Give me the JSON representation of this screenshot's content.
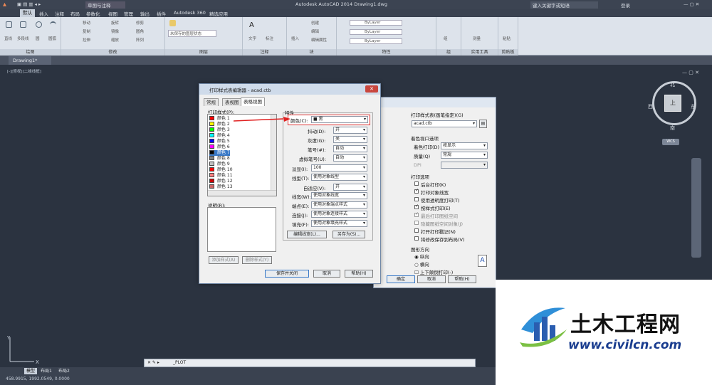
{
  "titlebar": {
    "workspace": "草图与注释",
    "app_title": "Autodesk AutoCAD 2014    Drawing1.dwg",
    "search_placeholder": "键入关键字或短语",
    "login": "登录"
  },
  "menu_tabs": [
    "默认",
    "插入",
    "注释",
    "布局",
    "参数化",
    "视图",
    "管理",
    "输出",
    "插件",
    "Autodesk 360",
    "精选应用"
  ],
  "ribbon": {
    "groups": [
      "绘图",
      "修改",
      "图层",
      "注释",
      "块",
      "特性",
      "组",
      "实用工具",
      "剪贴板"
    ],
    "draw_tools": [
      "直线",
      "多段线",
      "圆",
      "圆弧"
    ],
    "modify_tools": [
      "移动",
      "旋转",
      "修剪",
      "复制",
      "镜像",
      "圆角",
      "拉伸",
      "缩放",
      "阵列"
    ],
    "layer_state": "未保存的图层状态",
    "annotation_tools": [
      "文字",
      "标注"
    ],
    "block_tools": [
      "插入",
      "创建",
      "编辑",
      "编辑属性"
    ],
    "property_values": [
      "ByLayer",
      "ByLayer",
      "ByLayer"
    ],
    "utility_tools": [
      "测量",
      "组",
      "粘贴"
    ]
  },
  "document_tab": "Drawing1*",
  "viewport_label": "[-][俯视][二维线框]",
  "viewcube": {
    "north": "北",
    "south": "南",
    "east": "东",
    "west": "西",
    "top": "上",
    "wcs": "WCS"
  },
  "command_line": "_PLOT",
  "status": {
    "coordinates": "458.9915, 1992.0549, 0.0000",
    "layout_tabs": [
      "模型",
      "布局1",
      "布局2"
    ]
  },
  "plot_dialog": {
    "stylesheet_label": "打印样式表(画笔指定)(G)",
    "stylesheet_value": "acad.ctb",
    "shaded_viewport_label": "着色视口选项",
    "shade_plot_label": "着色打印(D)",
    "shade_plot_value": "按显示",
    "quality_label": "质量(Q)",
    "quality_value": "常规",
    "dpi_label": "DPI",
    "plot_options_label": "打印选项",
    "options": [
      {
        "label": "后台打印(K)",
        "checked": false
      },
      {
        "label": "打印对象线宽",
        "checked": true
      },
      {
        "label": "使用透明度打印(T)",
        "checked": false
      },
      {
        "label": "按样式打印(E)",
        "checked": true
      },
      {
        "label": "最后打印图纸空间",
        "checked": true
      },
      {
        "label": "隐藏图纸空间对象(J)",
        "checked": false
      },
      {
        "label": "打开打印戳记(N)",
        "checked": false
      },
      {
        "label": "将修改保存到布局(V)",
        "checked": false
      }
    ],
    "orientation_label": "图形方向",
    "orientations": [
      "纵向",
      "横向",
      "上下颠倒打印(-)"
    ],
    "ok": "确定",
    "cancel": "取消",
    "help": "帮助(H)"
  },
  "ctb_dialog": {
    "title": "打印样式表编辑器 - acad.ctb",
    "tabs": [
      "常规",
      "表视图",
      "表格视图"
    ],
    "styles_label": "打印样式(P):",
    "styles": [
      {
        "name": "颜色 1",
        "color": "#ff0000"
      },
      {
        "name": "颜色 2",
        "color": "#ffff00"
      },
      {
        "name": "颜色 3",
        "color": "#00ff00"
      },
      {
        "name": "颜色 4",
        "color": "#00ffff"
      },
      {
        "name": "颜色 5",
        "color": "#0000ff"
      },
      {
        "name": "颜色 6",
        "color": "#ff00ff"
      },
      {
        "name": "颜色 7",
        "color": "#000000"
      },
      {
        "name": "颜色 8",
        "color": "#808080"
      },
      {
        "name": "颜色 9",
        "color": "#c0c0c0"
      },
      {
        "name": "颜色 10",
        "color": "#ff0000"
      },
      {
        "name": "颜色 11",
        "color": "#ff7f7f"
      },
      {
        "name": "颜色 12",
        "color": "#cc0000"
      },
      {
        "name": "颜色 13",
        "color": "#cc6666"
      }
    ],
    "description_label": "说明(R):",
    "properties_label": "特性",
    "color_label": "颜色(C):",
    "color_value": "■ 黑",
    "dither_label": "抖动(D):",
    "dither_value": "开",
    "grayscale_label": "灰度(G):",
    "grayscale_value": "关",
    "pen_label": "笔号(#):",
    "pen_value": "自动",
    "vpen_label": "虚拟笔号(U):",
    "vpen_value": "自动",
    "screening_label": "淡显(I):",
    "screening_value": "100",
    "linetype_label": "线型(T):",
    "linetype_value": "使用对象线型",
    "adaptive_label": "自适应(V):",
    "adaptive_value": "开",
    "lineweight_label": "线宽(W):",
    "lineweight_value": "使用对象线宽",
    "endstyle_label": "端点(E):",
    "endstyle_value": "使用对象端点样式",
    "joinstyle_label": "连接(J):",
    "joinstyle_value": "使用对象连接样式",
    "fillstyle_label": "填充(F):",
    "fillstyle_value": "使用对象填充样式",
    "edit_lineweights": "编辑线宽(L)...",
    "save_as": "另存为(S)...",
    "add_style": "添加样式(A)",
    "delete_style": "删除样式(Y)",
    "save_close": "保存并关闭",
    "cancel": "取消",
    "help": "帮助(H)"
  },
  "watermark": {
    "brand": "土木工程网",
    "url": "www.civilcn.com"
  }
}
